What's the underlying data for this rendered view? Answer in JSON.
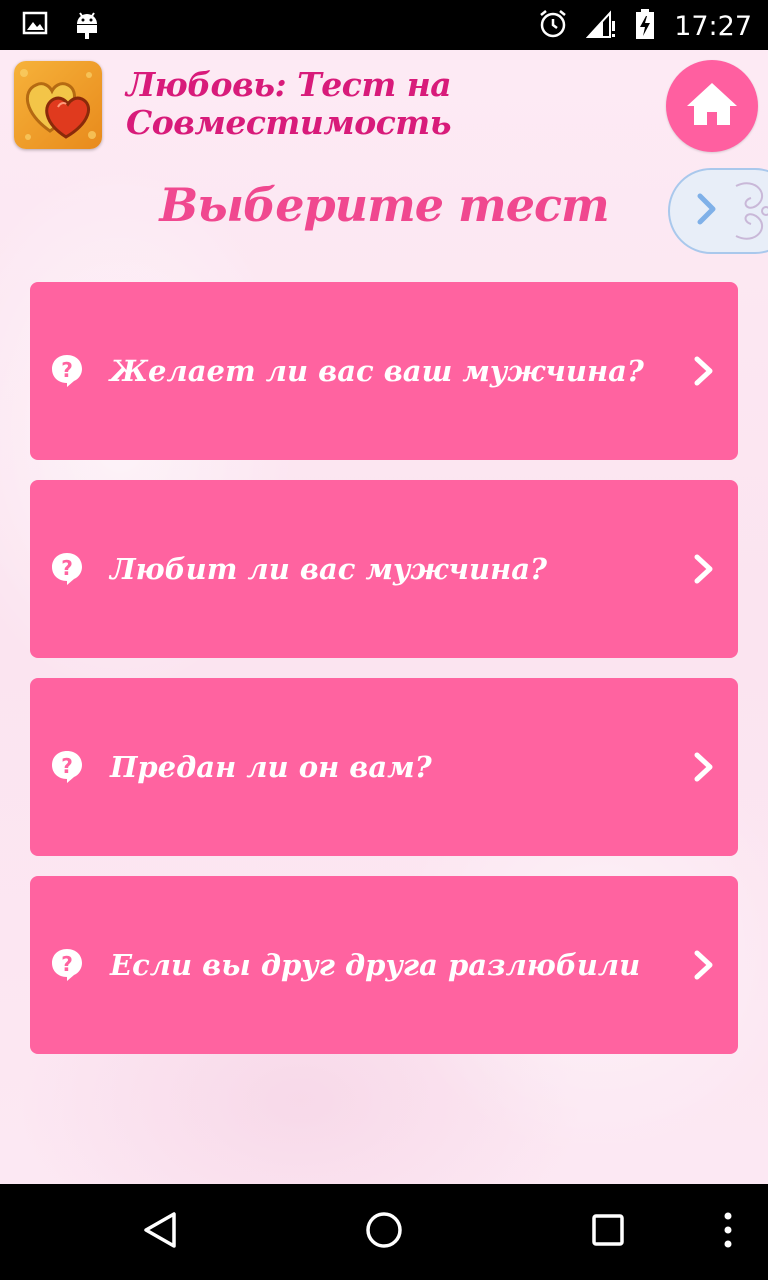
{
  "status_bar": {
    "time": "17:27",
    "icons": [
      "image-icon",
      "android-icon",
      "alarm-icon",
      "signal-icon",
      "battery-icon"
    ]
  },
  "header": {
    "app_title": "Любовь: Тест на Совместимость",
    "app_icon": "hearts-icon",
    "home_icon": "home-icon",
    "next_icon": "chevron-right-icon"
  },
  "main": {
    "heading": "Выберите тест",
    "tests": [
      {
        "label": "Желает ли вас ваш мужчина?"
      },
      {
        "label": "Любит ли вас мужчина?"
      },
      {
        "label": "Предан ли он вам?"
      },
      {
        "label": "Если вы друг друга разлюбили"
      }
    ]
  },
  "nav_bar": {
    "buttons": [
      "back-icon",
      "home-circle-icon",
      "recents-icon",
      "menu-dots-icon"
    ]
  },
  "colors": {
    "accent": "#ff63a0",
    "title": "#d81b7a",
    "heading": "#f0488f",
    "home_button": "#ff5fa0"
  }
}
